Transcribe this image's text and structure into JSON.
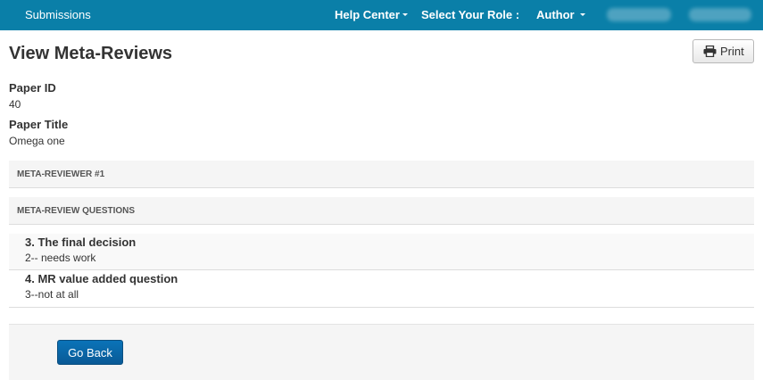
{
  "navbar": {
    "submissions": "Submissions",
    "help_center": "Help Center",
    "select_role_label": "Select Your Role :",
    "role": "Author",
    "background_color": "#0a7fa8"
  },
  "page": {
    "title": "View Meta-Reviews",
    "print_label": "Print"
  },
  "paper": {
    "id_label": "Paper ID",
    "id_value": "40",
    "title_label": "Paper Title",
    "title_value": "Omega one"
  },
  "sections": {
    "meta_reviewer": "META-REVIEWER #1",
    "questions_header": "META-REVIEW QUESTIONS"
  },
  "questions": [
    {
      "title": "3. The final decision",
      "answer": "2-- needs work"
    },
    {
      "title": "4. MR value added question",
      "answer": "3--not at all"
    }
  ],
  "footer": {
    "go_back_label": "Go Back",
    "button_color": "#0a64a6"
  },
  "icons": {
    "print": "printer-icon"
  }
}
